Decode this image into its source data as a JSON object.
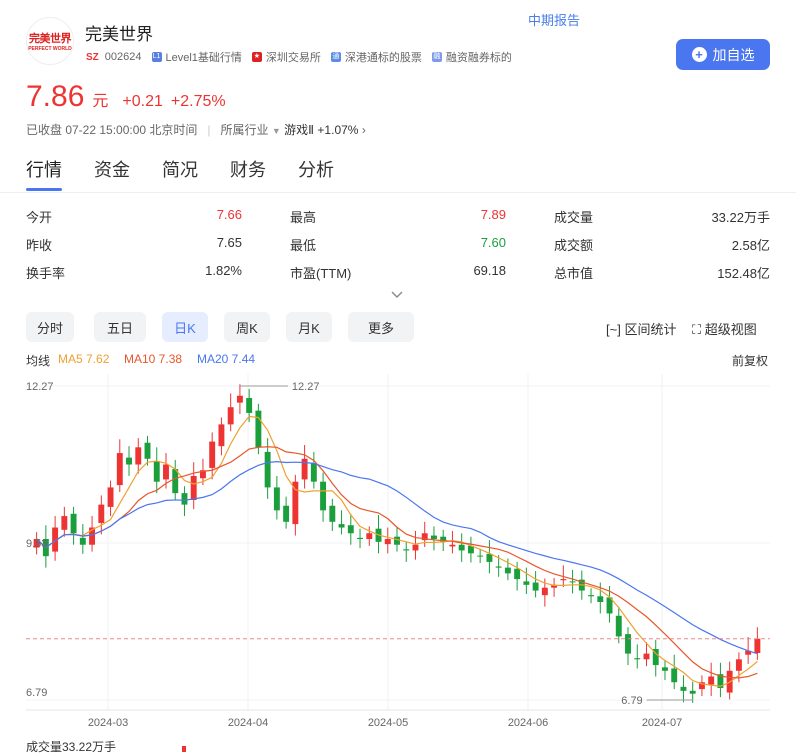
{
  "stock": {
    "name": "完美世界",
    "market": "SZ",
    "code": "002624",
    "logo_text": "完美世界",
    "logo_sub": "PERFECT WORLD"
  },
  "report_link": "中期报告",
  "tags": [
    "Level1基础行情",
    "深圳交易所",
    "深港通标的股票",
    "融资融券标的"
  ],
  "add_button": "加自选",
  "quote": {
    "price": "7.86",
    "unit": "元",
    "change": "+0.21",
    "change_pct": "+2.75%"
  },
  "status": {
    "text": "已收盘 07-22 15:00:00 北京时间",
    "industry_label": "所属行业",
    "industry": "游戏Ⅱ",
    "industry_change": "+1.07%"
  },
  "tabs": [
    "行情",
    "资金",
    "简况",
    "财务",
    "分析"
  ],
  "stats": [
    {
      "label": "今开",
      "value": "7.66",
      "color": "#e33"
    },
    {
      "label": "最高",
      "value": "7.89",
      "color": "#e33"
    },
    {
      "label": "成交量",
      "value": "33.22万手",
      "color": "#333"
    },
    {
      "label": "昨收",
      "value": "7.65",
      "color": "#333"
    },
    {
      "label": "最低",
      "value": "7.60",
      "color": "#1a9f3c"
    },
    {
      "label": "成交额",
      "value": "2.58亿",
      "color": "#333"
    },
    {
      "label": "换手率",
      "value": "1.82%",
      "color": "#333"
    },
    {
      "label": "市盈(TTM)",
      "value": "69.18",
      "color": "#333"
    },
    {
      "label": "总市值",
      "value": "152.48亿",
      "color": "#333"
    }
  ],
  "periods": [
    "分时",
    "五日",
    "日K",
    "周K",
    "月K",
    "更多"
  ],
  "active_period": "日K",
  "tools": {
    "range": "区间统计",
    "super": "超级视图"
  },
  "ma": {
    "title": "均线",
    "ma5": "MA5 7.62",
    "ma10": "MA10 7.38",
    "ma20": "MA20 7.44",
    "adjust": "前复权",
    "ma5_color": "#f0a030",
    "ma10_color": "#e8562a",
    "ma20_color": "#4a76f0"
  },
  "volume_label": "成交量33.22万手",
  "colors": {
    "up": "#e33",
    "down": "#1a9f3c",
    "accent": "#4a76f0"
  },
  "chart_data": {
    "type": "candlestick",
    "y_ticks": [
      "12.27",
      "9.53",
      "6.79"
    ],
    "x_ticks": [
      "2024-03",
      "2024-04",
      "2024-05",
      "2024-06",
      "2024-07"
    ],
    "ylim": [
      6.79,
      12.27
    ],
    "max_label": "12.27",
    "min_label": "6.79",
    "last_close": 7.86,
    "closes": [
      9.6,
      9.3,
      9.8,
      10.0,
      9.7,
      9.5,
      9.8,
      10.2,
      10.5,
      11.1,
      10.9,
      11.2,
      11.0,
      10.6,
      10.9,
      10.4,
      10.2,
      10.7,
      10.8,
      11.3,
      11.6,
      11.9,
      12.1,
      11.8,
      11.2,
      10.5,
      10.1,
      9.9,
      10.6,
      11.0,
      10.6,
      10.1,
      9.9,
      9.8,
      9.7,
      9.6,
      9.7,
      9.55,
      9.6,
      9.5,
      9.4,
      9.5,
      9.7,
      9.6,
      9.55,
      9.5,
      9.4,
      9.35,
      9.3,
      9.2,
      9.1,
      9.0,
      8.9,
      8.8,
      8.7,
      8.75,
      8.8,
      8.9,
      8.85,
      8.7,
      8.6,
      8.5,
      8.3,
      7.9,
      7.6,
      7.5,
      7.6,
      7.4,
      7.3,
      7.1,
      6.95,
      6.9,
      7.1,
      7.2,
      7.0,
      7.3,
      7.5,
      7.65,
      7.86
    ]
  }
}
